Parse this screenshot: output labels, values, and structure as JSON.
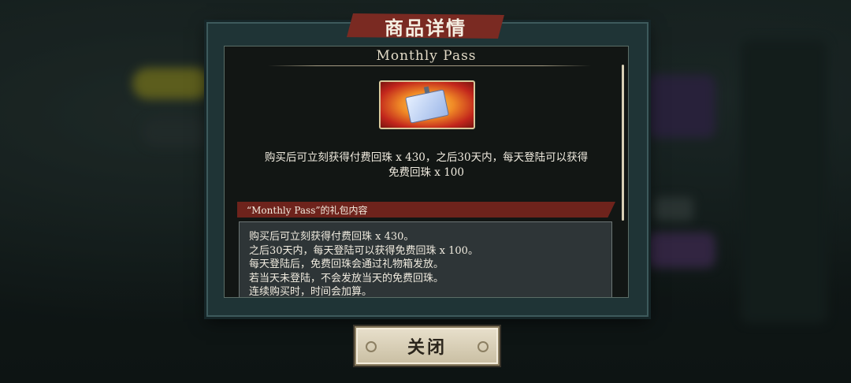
{
  "dialog": {
    "title": "商品详情",
    "item_name": "Monthly Pass",
    "description_line1": "购买后可立刻获得付费回珠 x 430，之后30天内，每天登陆可以获得",
    "description_line2": "免费回珠 x 100",
    "section_title": "“Monthly Pass”的礼包内容",
    "details": [
      "购买后可立刻获得付费回珠 x 430。",
      "之后30天内，每天登陆可以获得免费回珠 x 100。",
      "每天登陆后，免费回珠会通过礼物箱发放。",
      "若当天未登陆，不会发放当天的免费回珠。",
      "连续购买时，时间会加算。"
    ],
    "close_label": "关闭"
  },
  "icons": {
    "item": "id-card-pass-icon",
    "ornament": "ring-ornament-icon"
  },
  "colors": {
    "banner": "#7a2a22",
    "frame": "#1f3436",
    "button": "#e8e0cc"
  }
}
